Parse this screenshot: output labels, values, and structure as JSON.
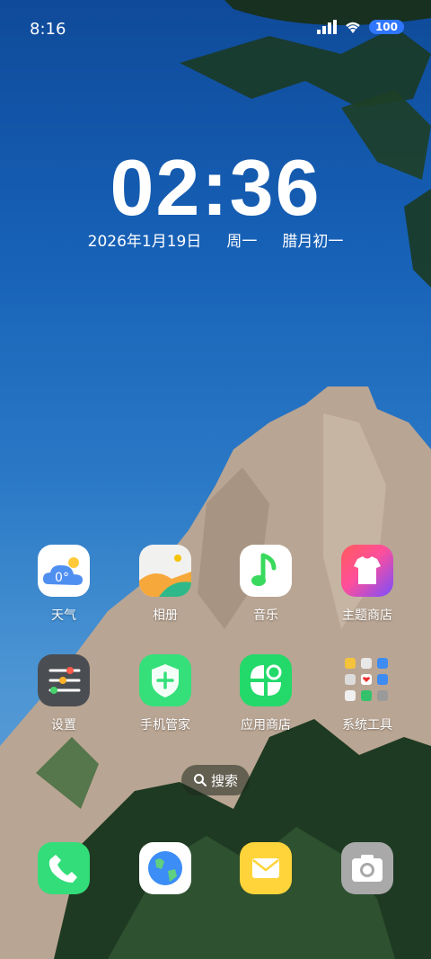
{
  "status": {
    "time": "8:16",
    "battery": "100"
  },
  "clock": {
    "time": "02:36",
    "date": "2026年1月19日",
    "weekday": "周一",
    "lunar": "腊月初一"
  },
  "apps": [
    {
      "label": "天气",
      "icon": "weather-icon",
      "extra": "0°"
    },
    {
      "label": "相册",
      "icon": "gallery-icon"
    },
    {
      "label": "音乐",
      "icon": "music-icon"
    },
    {
      "label": "主题商店",
      "icon": "theme-store-icon"
    },
    {
      "label": "设置",
      "icon": "settings-icon"
    },
    {
      "label": "手机管家",
      "icon": "phone-manager-icon"
    },
    {
      "label": "应用商店",
      "icon": "app-store-icon"
    },
    {
      "label": "系统工具",
      "icon": "system-tools-folder-icon"
    }
  ],
  "search": {
    "label": "搜索"
  },
  "dock": [
    {
      "icon": "phone-icon"
    },
    {
      "icon": "browser-icon"
    },
    {
      "icon": "messages-icon"
    },
    {
      "icon": "camera-icon"
    }
  ],
  "colors": {
    "battery": "#2f76ff",
    "green_accent": "#35e07a"
  }
}
